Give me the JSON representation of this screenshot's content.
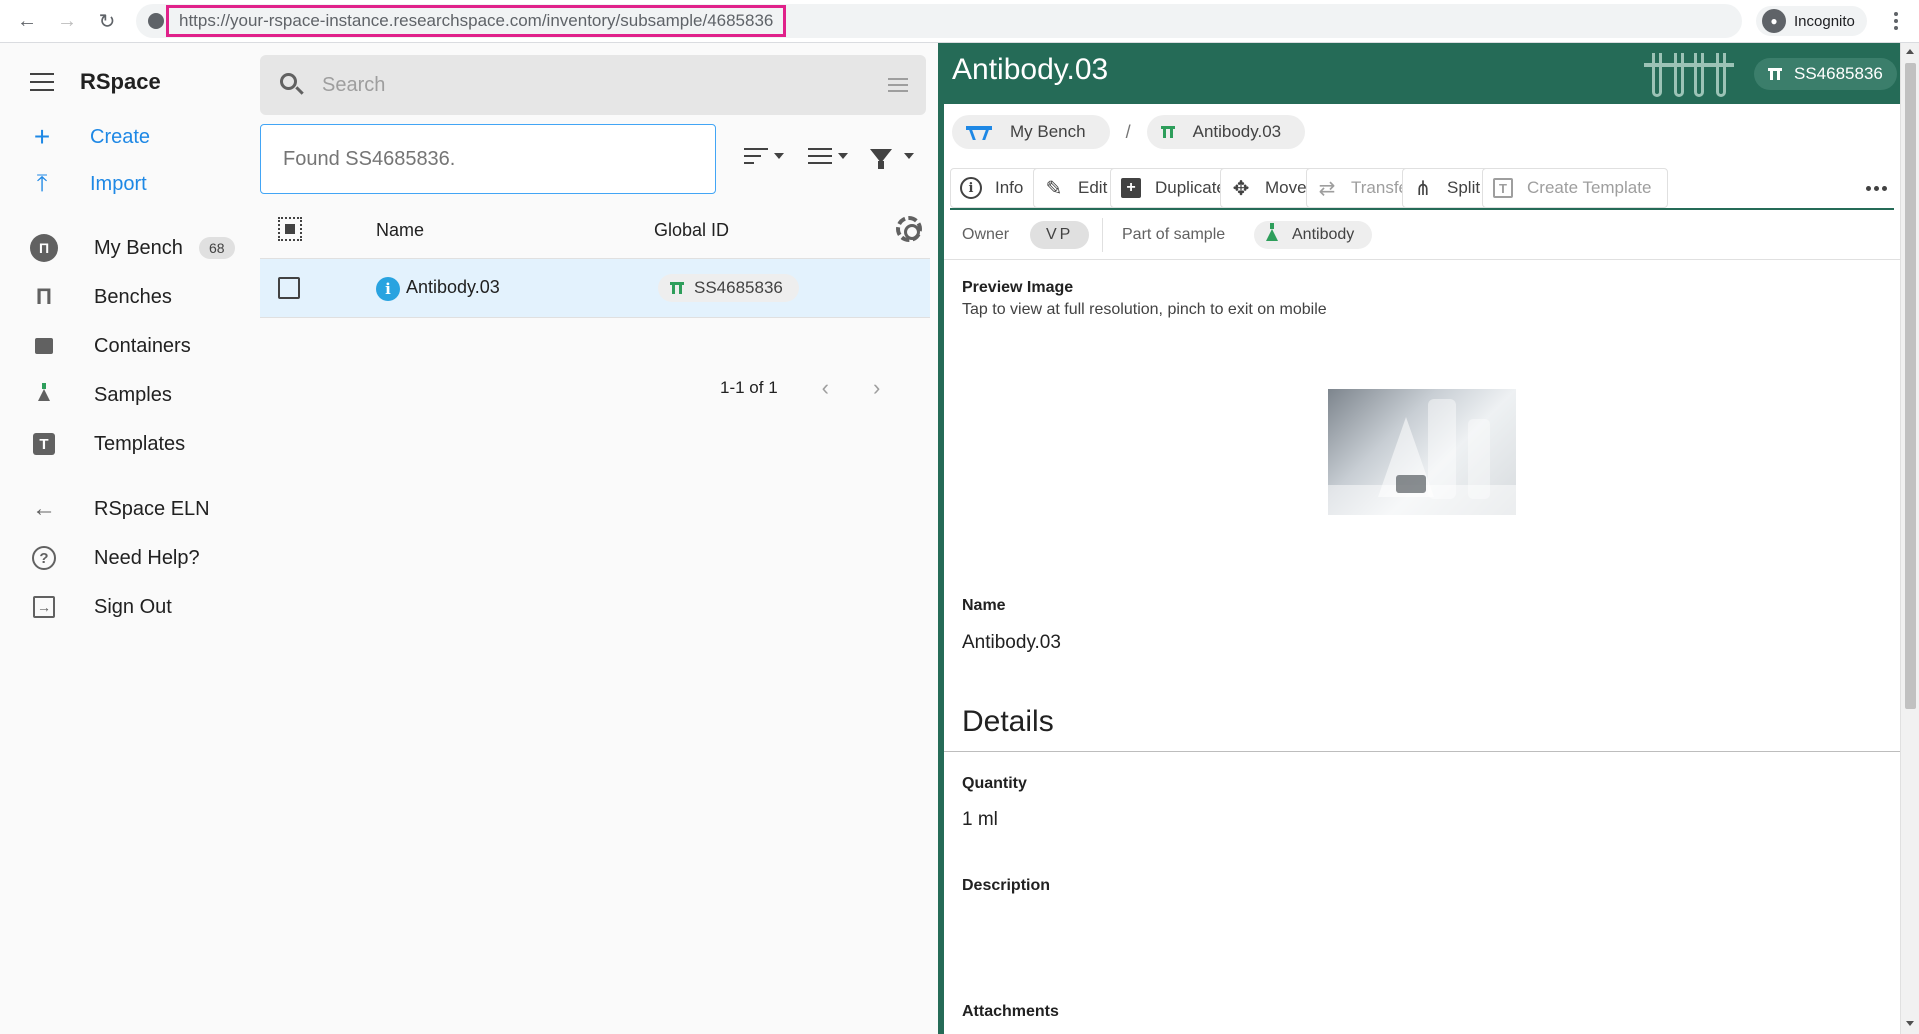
{
  "browser": {
    "url_host": "https://your-rspace-instance.researchspace.com",
    "url_path": "/inventory/subsample/4685836",
    "profile_label": "Incognito"
  },
  "sidebar": {
    "app_name": "RSpace",
    "actions": [
      {
        "label": "Create",
        "icon": "plus-icon"
      },
      {
        "label": "Import",
        "icon": "upload-icon"
      }
    ],
    "items": [
      {
        "label": "My Bench",
        "count": "68",
        "icon": "bench-icon"
      },
      {
        "label": "Benches",
        "icon": "benches-icon"
      },
      {
        "label": "Containers",
        "icon": "container-icon"
      },
      {
        "label": "Samples",
        "icon": "flask-icon"
      },
      {
        "label": "Templates",
        "icon": "template-icon"
      },
      {
        "label": "RSpace ELN",
        "icon": "arrow-left-icon"
      },
      {
        "label": "Need Help?",
        "icon": "help-circle-icon"
      },
      {
        "label": "Sign Out",
        "icon": "sign-out-icon"
      }
    ]
  },
  "list": {
    "search_placeholder": "Search",
    "found_text": "Found SS4685836.",
    "columns": {
      "name": "Name",
      "global_id": "Global ID"
    },
    "rows": [
      {
        "name": "Antibody.03",
        "global_id": "SS4685836"
      }
    ],
    "pagination": "1-1 of 1"
  },
  "detail": {
    "title": "Antibody.03",
    "global_id": "SS4685836",
    "breadcrumbs": [
      {
        "label": "My Bench",
        "icon": "bench-icon"
      },
      {
        "label": "Antibody.03",
        "icon": "subsample-icon"
      }
    ],
    "breadcrumb_separator": "/",
    "actions": [
      {
        "label": "Info",
        "icon": "info-icon",
        "enabled": true
      },
      {
        "label": "Edit",
        "icon": "pencil-icon",
        "enabled": true
      },
      {
        "label": "Duplicate",
        "icon": "duplicate-icon",
        "enabled": true
      },
      {
        "label": "Move",
        "icon": "move-icon",
        "enabled": true
      },
      {
        "label": "Transfer",
        "icon": "transfer-icon",
        "enabled": false
      },
      {
        "label": "Split",
        "icon": "split-icon",
        "enabled": true
      },
      {
        "label": "Create Template",
        "icon": "template-icon",
        "enabled": false
      }
    ],
    "owner_label": "Owner",
    "owner_value": "VP",
    "part_of_label": "Part of sample",
    "part_of_value": "Antibody",
    "preview_label": "Preview Image",
    "preview_hint": "Tap to view at full resolution, pinch to exit on mobile",
    "name_label": "Name",
    "name_value": "Antibody.03",
    "details_heading": "Details",
    "quantity_label": "Quantity",
    "quantity_value": "1 ml",
    "description_label": "Description",
    "attachments_label": "Attachments"
  },
  "colors": {
    "accent_blue": "#1e88e5",
    "header_green": "#256b57",
    "url_highlight": "#e0218a",
    "selected_row": "#e3f2fd"
  }
}
